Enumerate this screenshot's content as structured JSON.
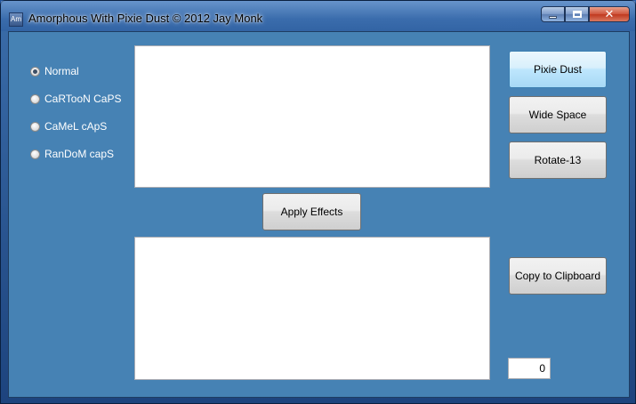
{
  "window": {
    "title": "Amorphous With Pixie Dust © 2012 Jay Monk",
    "icon_text": "Am"
  },
  "case_options": [
    {
      "label": "Normal",
      "checked": true
    },
    {
      "label": "CaRTooN CaPS",
      "checked": false
    },
    {
      "label": "CaMeL cApS",
      "checked": false
    },
    {
      "label": "RanDoM capS",
      "checked": false
    }
  ],
  "input_text": {
    "value": ""
  },
  "output_text": {
    "value": ""
  },
  "buttons": {
    "pixie_dust": "Pixie Dust",
    "wide_space": "Wide Space",
    "rotate_13": "Rotate-13",
    "apply_effects": "Apply Effects",
    "copy_clipboard": "Copy to Clipboard"
  },
  "counter": {
    "value": "0"
  },
  "colors": {
    "client_background": "#4682b4",
    "active_button": "#bee6fd",
    "close_button": "#c0391f"
  }
}
